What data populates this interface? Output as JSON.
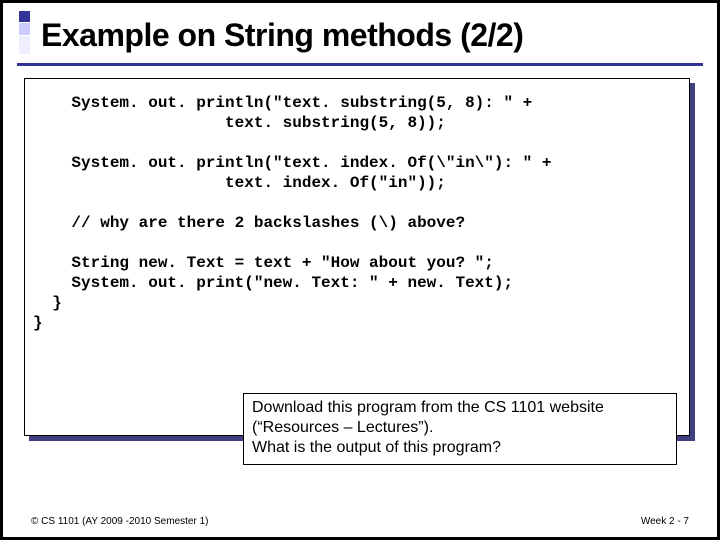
{
  "title": "Example on String methods (2/2)",
  "code": {
    "l1": "    System. out. println(\"text. substring(5, 8): \" +",
    "l2": "                    text. substring(5, 8));",
    "l3": "",
    "l4": "    System. out. println(\"text. index. Of(\\\"in\\\"): \" +",
    "l5": "                    text. index. Of(\"in\"));",
    "l6": "",
    "l7": "    // why are there 2 backslashes (\\) above?",
    "l8": "",
    "l9": "    String new. Text = text + \"How about you? \";",
    "l10": "    System. out. print(\"new. Text: \" + new. Text);",
    "l11": "  }",
    "l12": "}"
  },
  "note": {
    "l1": "Download this program from the CS 1101 website",
    "l2": "(“Resources – Lectures”).",
    "l3": "What is the output of this program?"
  },
  "footer": {
    "left": "© CS 1101 (AY 2009 -2010 Semester 1)",
    "right": "Week 2 - 7"
  }
}
